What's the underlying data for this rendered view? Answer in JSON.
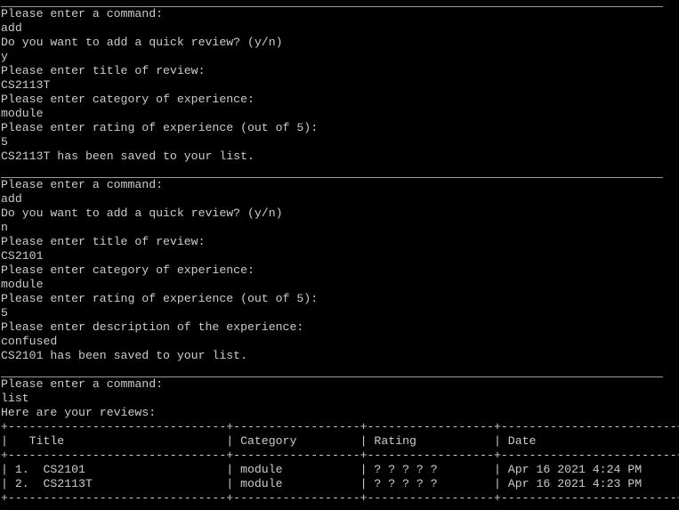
{
  "blocks": [
    {
      "lines": [
        "Please enter a command:",
        "add",
        "Do you want to add a quick review? (y/n)",
        "y",
        "Please enter title of review:",
        "CS2113T",
        "Please enter category of experience:",
        "module",
        "Please enter rating of experience (out of 5):",
        "5",
        "CS2113T has been saved to your list."
      ]
    },
    {
      "lines": [
        "Please enter a command:",
        "add",
        "Do you want to add a quick review? (y/n)",
        "n",
        "Please enter title of review:",
        "CS2101",
        "Please enter category of experience:",
        "module",
        "Please enter rating of experience (out of 5):",
        "5",
        "Please enter description of the experience:",
        "confused",
        "CS2101 has been saved to your list."
      ]
    },
    {
      "lines": [
        "Please enter a command:",
        "list",
        "Here are your reviews:"
      ]
    }
  ],
  "table": {
    "border": "+-------------------------------+------------------+------------------+-------------------------+",
    "header": "|   Title                       | Category         | Rating           | Date                    |",
    "spacer": "|                               |                  |                  |                         |",
    "rows": [
      "| 1.  CS2101                    | module           | ? ? ? ? ?        | Apr 16 2021 4:24 PM     |",
      "| 2.  CS2113T                   | module           | ? ? ? ? ?        | Apr 16 2021 4:23 PM     |"
    ]
  },
  "colors": {
    "background": "#000000",
    "text": "#cccccc",
    "rule": "#9a9a9a"
  }
}
